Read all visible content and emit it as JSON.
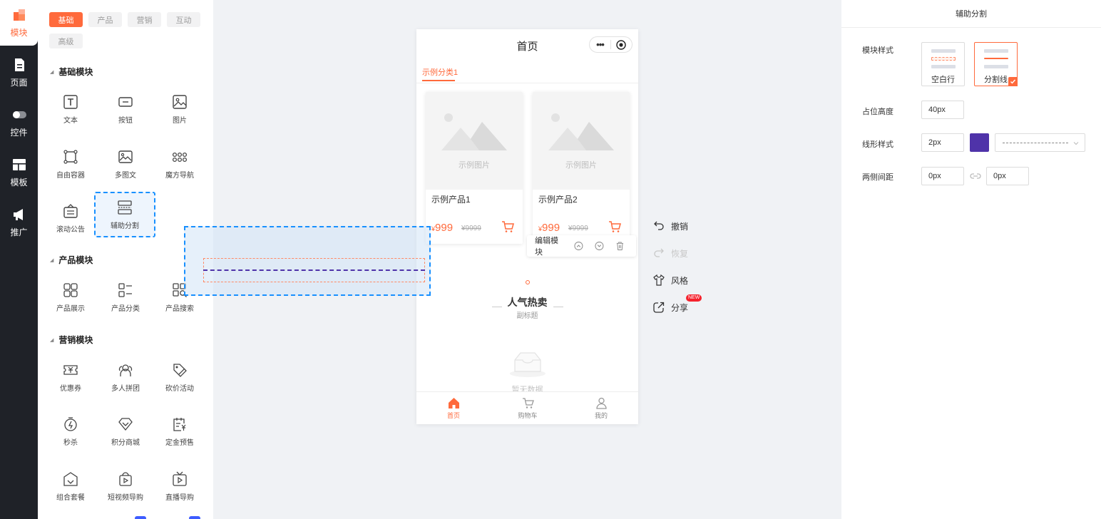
{
  "rail": {
    "items": [
      {
        "label": "模块",
        "icon": "blocks-icon",
        "active": true
      },
      {
        "label": "页面",
        "icon": "page-icon"
      },
      {
        "label": "控件",
        "icon": "toggle-icon"
      },
      {
        "label": "模板",
        "icon": "template-icon"
      },
      {
        "label": "推广",
        "icon": "megaphone-icon"
      }
    ]
  },
  "widget_panel": {
    "category_tabs": [
      "基础",
      "产品",
      "营销",
      "互动",
      "高级"
    ],
    "active_category": "基础",
    "groups": [
      {
        "title": "基础模块",
        "items": [
          "文本",
          "按钮",
          "图片",
          "自由容器",
          "多图文",
          "魔方导航",
          "滚动公告",
          "辅助分割"
        ]
      },
      {
        "title": "产品模块",
        "items": [
          "产品展示",
          "产品分类",
          "产品搜索"
        ]
      },
      {
        "title": "营销模块",
        "items": [
          "优惠券",
          "多人拼团",
          "砍价活动",
          "秒杀",
          "积分商城",
          "定金预售",
          "组合套餐",
          "短视频导购",
          "直播导购"
        ]
      }
    ],
    "selected_widget": "辅助分割"
  },
  "phone": {
    "title": "首页",
    "capsule_dots": "•••",
    "tab": "示例分类1",
    "products": [
      {
        "image_label": "示例图片",
        "name": "示例产品1",
        "currency": "¥",
        "price": "999",
        "original_price": "¥9999"
      },
      {
        "image_label": "示例图片",
        "name": "示例产品2",
        "currency": "¥",
        "price": "999",
        "original_price": "¥9999"
      }
    ],
    "section_title": "人气热卖",
    "section_subtitle": "副标题",
    "empty_text": "暂无数据",
    "tabbar": [
      {
        "label": "首页",
        "active": true
      },
      {
        "label": "购物车"
      },
      {
        "label": "我的"
      }
    ]
  },
  "module_toolbar": {
    "label": "编辑模块"
  },
  "actions": [
    {
      "label": "撤销",
      "enabled": true
    },
    {
      "label": "恢复",
      "enabled": false
    },
    {
      "label": "风格",
      "enabled": true
    },
    {
      "label": "分享",
      "enabled": true,
      "badge": "NEW"
    }
  ],
  "properties": {
    "title": "辅助分割",
    "module_style_label": "模块样式",
    "style_options": [
      {
        "label": "空白行",
        "active": false
      },
      {
        "label": "分割线",
        "active": true
      }
    ],
    "height_label": "占位高度",
    "height_value": "40px",
    "line_style_label": "线形样式",
    "line_width_value": "2px",
    "line_color": "#4f33a9",
    "spacing_label": "两侧间距",
    "spacing_left": "0px",
    "spacing_right": "0px"
  },
  "colors": {
    "accent": "#ff6a3c",
    "selection": "#1890ff",
    "rail": "#1f2228"
  }
}
